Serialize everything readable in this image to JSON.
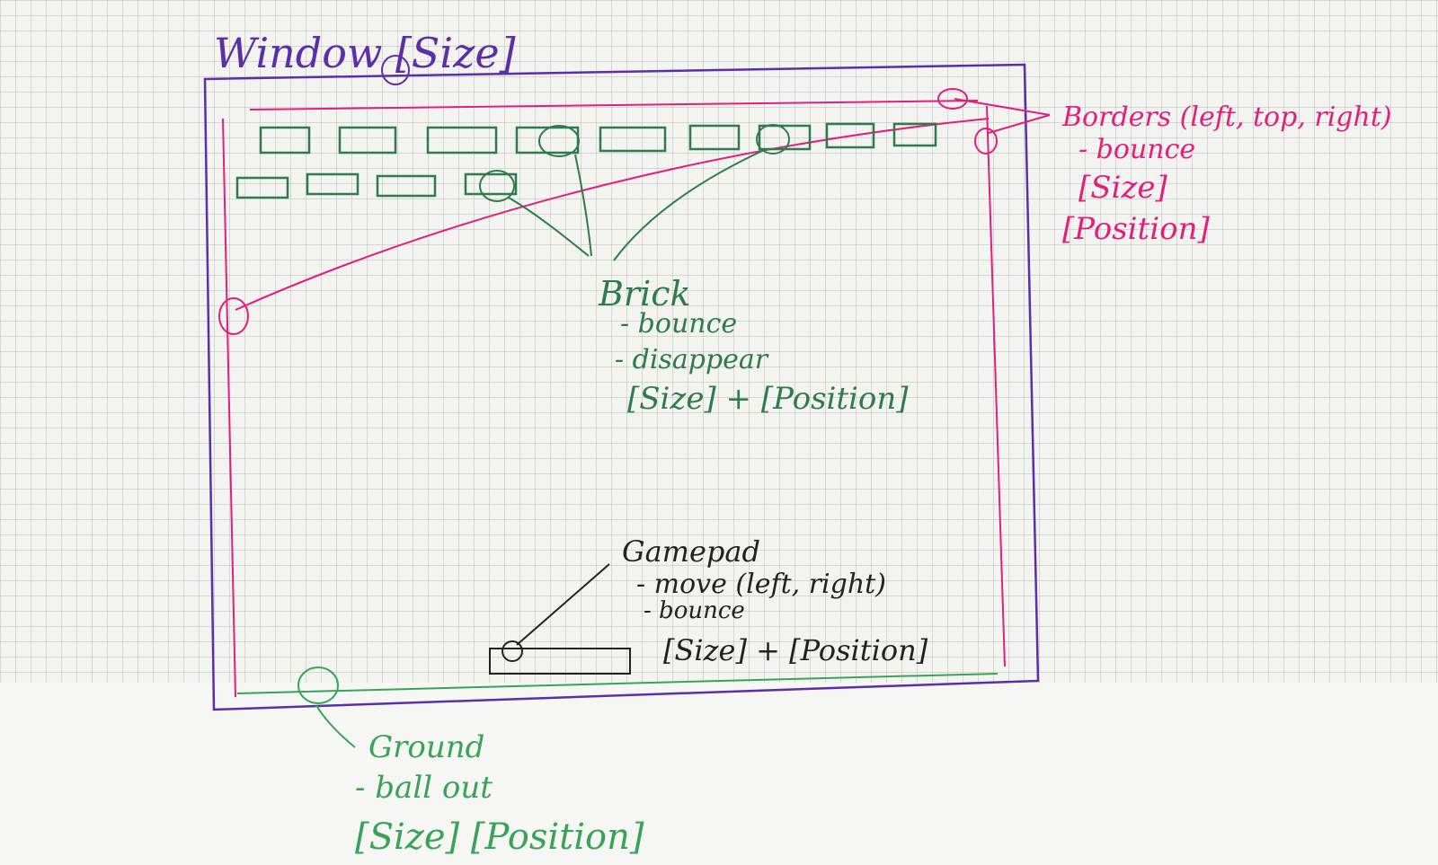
{
  "window": {
    "label": "Window [Size]"
  },
  "borders": {
    "title": "Borders (left, top, right)",
    "lines": [
      "- bounce",
      "[Size]",
      "[Position]"
    ]
  },
  "brick": {
    "title": "Brick",
    "lines": [
      "- bounce",
      "- disappear",
      "[Size] + [Position]"
    ]
  },
  "gamepad": {
    "title": "Gamepad",
    "lines": [
      "- move (left, right)",
      "- bounce",
      "[Size] + [Position]"
    ]
  },
  "ground": {
    "title": "Ground",
    "lines": [
      "- ball out",
      "[Size] [Position]"
    ]
  },
  "colors": {
    "window": "#5a2fa8",
    "borders": "#e0207a",
    "brick": "#2f7a4f",
    "ground": "#3aa35a",
    "pencil": "#222222",
    "grid": "#b9bab6"
  }
}
